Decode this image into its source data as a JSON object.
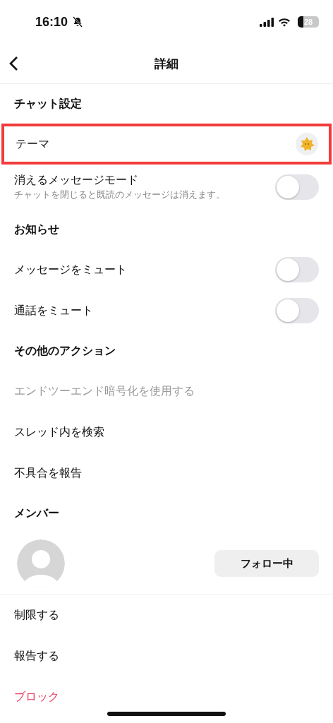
{
  "status_bar": {
    "time": "16:10",
    "battery": "28"
  },
  "nav": {
    "title": "詳細"
  },
  "sections": [
    {
      "heading": "チャット設定",
      "items": [
        {
          "kind": "theme",
          "label": "テーマ",
          "highlighted": true
        },
        {
          "kind": "toggle",
          "label": "消えるメッセージモード",
          "subtitle": "チャットを閉じると既読のメッセージは消えます。",
          "on": false
        }
      ]
    },
    {
      "heading": "お知らせ",
      "items": [
        {
          "kind": "toggle",
          "label": "メッセージをミュート",
          "on": false
        },
        {
          "kind": "toggle",
          "label": "通話をミュート",
          "on": false
        }
      ]
    },
    {
      "heading": "その他のアクション",
      "items": [
        {
          "kind": "link",
          "label": "エンドツーエンド暗号化を使用する",
          "disabled": true
        },
        {
          "kind": "link",
          "label": "スレッド内を検索",
          "disabled": false
        },
        {
          "kind": "link",
          "label": "不具合を報告",
          "disabled": false
        }
      ]
    },
    {
      "heading": "メンバー",
      "items": [
        {
          "kind": "member",
          "button": "フォロー中"
        }
      ]
    }
  ],
  "actions": [
    {
      "label": "制限する",
      "danger": false
    },
    {
      "label": "報告する",
      "danger": false
    },
    {
      "label": "ブロック",
      "danger": true
    }
  ]
}
